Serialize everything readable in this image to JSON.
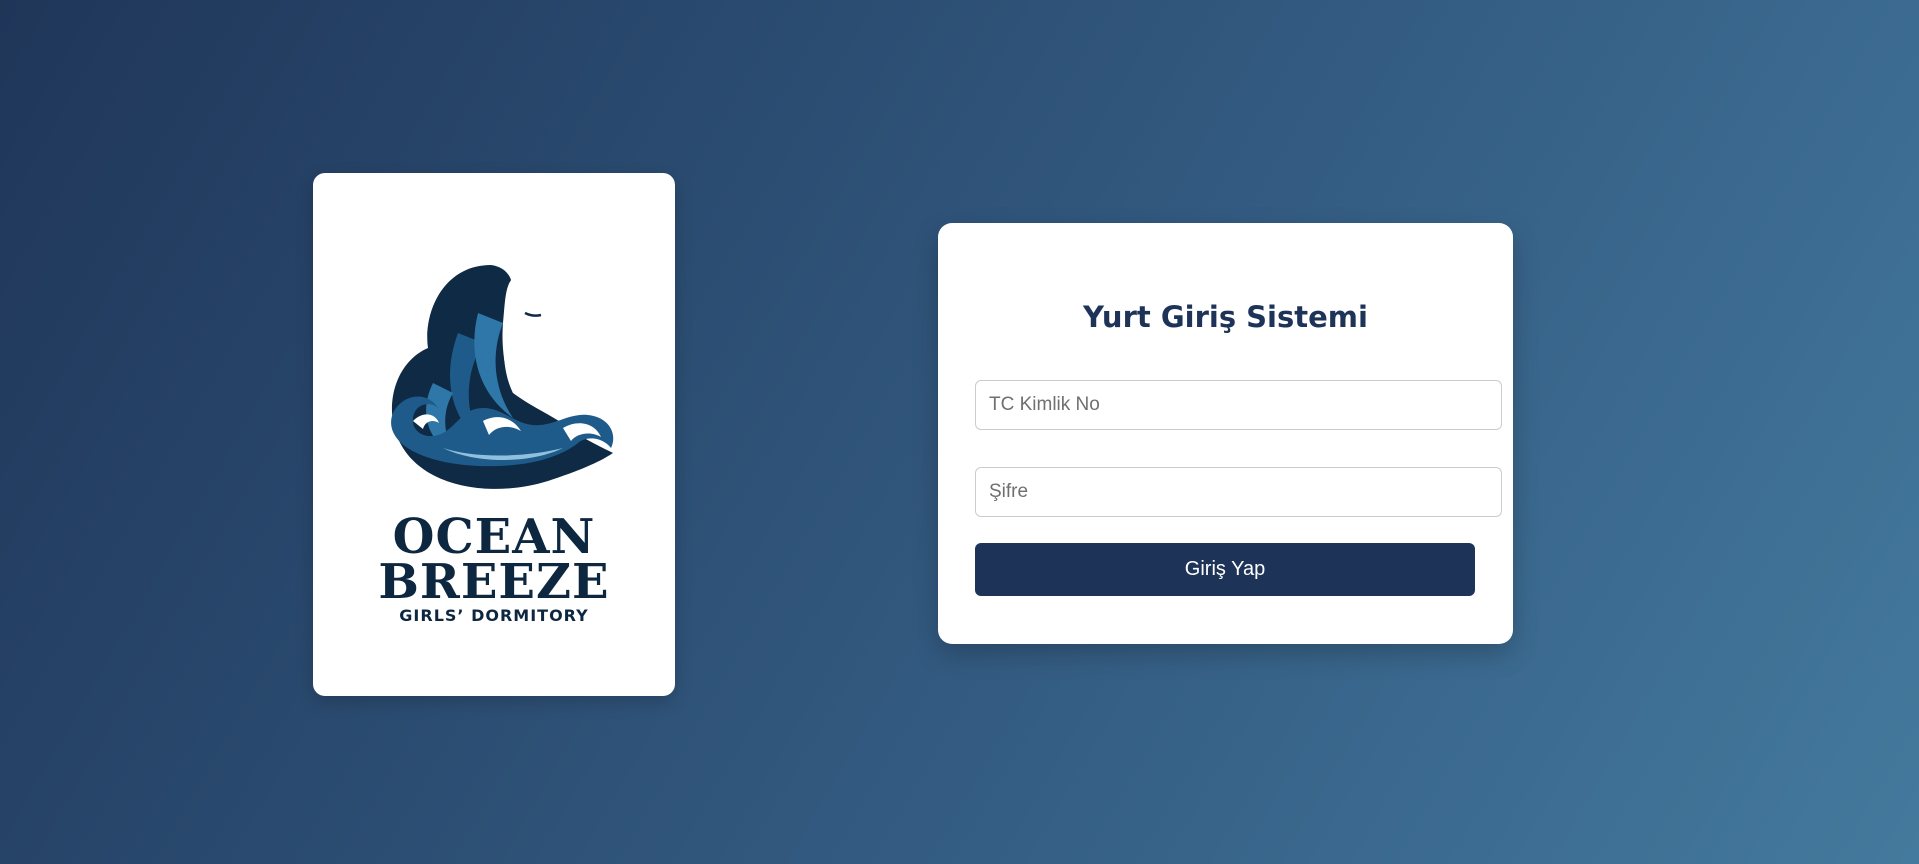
{
  "logo": {
    "icon": "woman-profile-waves-logo",
    "line1": "OCEAN",
    "line2": "BREEZE",
    "subline": "GIRLS’ DORMITORY"
  },
  "login": {
    "title": "Yurt Giriş Sistemi",
    "tc_placeholder": "TC Kimlik No",
    "password_placeholder": "Şifre",
    "submit_label": "Giriş Yap"
  },
  "colors": {
    "primary": "#1e3358",
    "background_start": "#1f3659",
    "background_end": "#447a9d"
  }
}
